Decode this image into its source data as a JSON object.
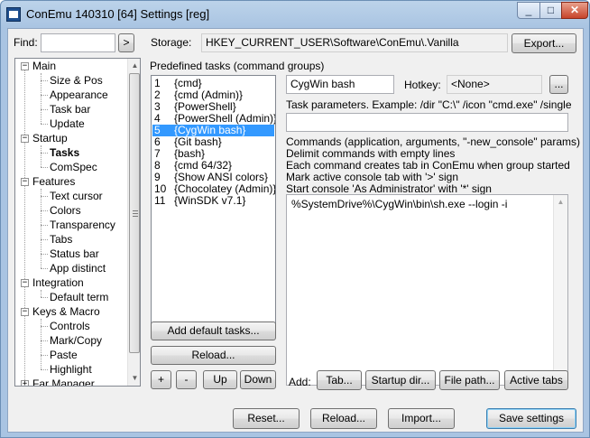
{
  "window": {
    "title": "ConEmu 140310 [64] Settings [reg]",
    "minimize": "_",
    "maximize": "□",
    "close": "✕"
  },
  "find": {
    "label": "Find:",
    "value": "",
    "go": ">"
  },
  "storage": {
    "label": "Storage:",
    "value": "HKEY_CURRENT_USER\\Software\\ConEmu\\.Vanilla",
    "export": "Export..."
  },
  "tree": {
    "main": "Main",
    "size_pos": "Size & Pos",
    "appearance": "Appearance",
    "task_bar": "Task bar",
    "update": "Update",
    "startup": "Startup",
    "tasks": "Tasks",
    "comspec": "ComSpec",
    "features": "Features",
    "text_cursor": "Text cursor",
    "colors": "Colors",
    "transparency": "Transparency",
    "tabs": "Tabs",
    "status_bar": "Status bar",
    "app_distinct": "App distinct",
    "integration": "Integration",
    "default_term": "Default term",
    "keys_macro": "Keys & Macro",
    "controls": "Controls",
    "mark_copy": "Mark/Copy",
    "paste": "Paste",
    "highlight": "Highlight",
    "far_manager": "Far Manager"
  },
  "tasks": {
    "group_label": "Predefined tasks (command groups)",
    "items": [
      {
        "num": "1",
        "name": "{cmd}"
      },
      {
        "num": "2",
        "name": "{cmd (Admin)}"
      },
      {
        "num": "3",
        "name": "{PowerShell}"
      },
      {
        "num": "4",
        "name": "{PowerShell (Admin)}"
      },
      {
        "num": "5",
        "name": "{CygWin bash}"
      },
      {
        "num": "6",
        "name": "{Git bash}"
      },
      {
        "num": "7",
        "name": "{bash}"
      },
      {
        "num": "8",
        "name": "{cmd 64/32}"
      },
      {
        "num": "9",
        "name": "{Show ANSI colors}"
      },
      {
        "num": "10",
        "name": "{Chocolatey (Admin)}"
      },
      {
        "num": "11",
        "name": "{WinSDK v7.1}"
      }
    ],
    "selected_index": 4,
    "add_default": "Add default tasks...",
    "reload": "Reload...",
    "plus": "+",
    "minus": "-",
    "up": "Up",
    "down": "Down"
  },
  "editor": {
    "task_name": "CygWin bash",
    "hotkey_label": "Hotkey:",
    "hotkey_value": "<None>",
    "hotkey_browse": "...",
    "params_label": "Task parameters. Example: /dir \"C:\\\" /icon \"cmd.exe\" /single",
    "params_value": "",
    "help": [
      "Commands (application, arguments, \"-new_console\" params)",
      "Delimit commands with empty lines",
      "Each command creates tab in ConEmu when group started",
      "Mark active console tab with '>' sign",
      "Start console 'As Administrator' with '*' sign"
    ],
    "commands": "%SystemDrive%\\CygWin\\bin\\sh.exe --login -i",
    "add_label": "Add:",
    "add_tab": "Tab...",
    "add_startup_dir": "Startup dir...",
    "add_file_path": "File path...",
    "add_active_tabs": "Active tabs"
  },
  "footer": {
    "reset": "Reset...",
    "reload": "Reload...",
    "import": "Import...",
    "save": "Save settings"
  }
}
